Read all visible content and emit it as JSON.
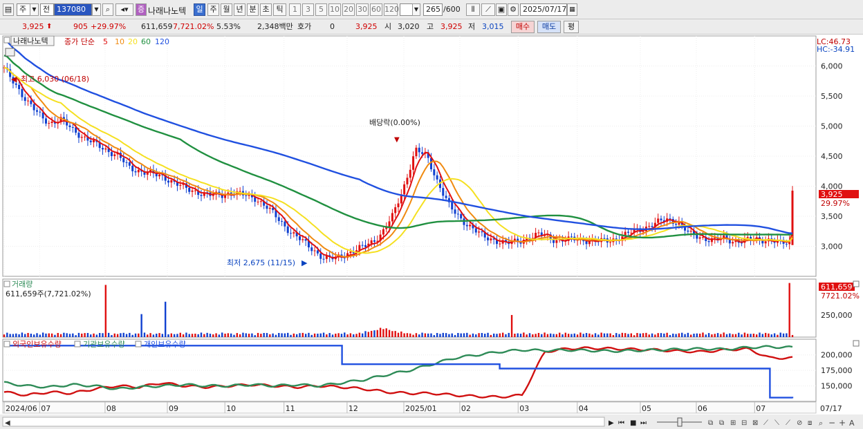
{
  "toolbar": {
    "period_label": "주",
    "mode_label": "전",
    "code": "137080",
    "company_name": "나래나노텍",
    "periods": [
      "일",
      "주",
      "월",
      "년",
      "분",
      "초",
      "틱"
    ],
    "active_period": "일",
    "numbers": [
      "1",
      "3",
      "5",
      "10",
      "20",
      "30",
      "60",
      "120"
    ],
    "count_value": "265",
    "count_total": "/600",
    "date": "2025/07/17"
  },
  "quote": {
    "price": "3,925",
    "change": "905",
    "change_pct": "+29.97%",
    "volume": "611,659",
    "volume_pct": "7,721.02%",
    "turnover": "5.53%",
    "amount": "2,348백만",
    "hoga_label": "호가",
    "hoga_value": "0",
    "hoga_price": "3,925",
    "open_label": "시",
    "open": "3,020",
    "high_label": "고",
    "high": "3,925",
    "low_label": "저",
    "low": "3,015",
    "buy_label": "매수",
    "sell_label": "매도",
    "eval_label": "평"
  },
  "price_panel": {
    "name_tag": "나래나노텍",
    "ma_label": "종가 단순",
    "ma_periods": [
      "5",
      "10",
      "20",
      "60",
      "120"
    ],
    "ma_colors": [
      "#e01010",
      "#f08a10",
      "#f5e020",
      "#209040",
      "#2050e0"
    ],
    "lc_label": "LC:46.73",
    "hc_label": "HC:-34.91",
    "high_note": "최고 6,030 (06/18)",
    "low_note": "최저 2,675 (11/15)",
    "dividend_note": "배당락(0.00%)",
    "last_price_tag": "3,925",
    "last_pct_tag": "29.97%"
  },
  "volume_panel": {
    "title": "거래량",
    "subtitle": "611,659주(7,721.02%)",
    "last_tag": "611,659",
    "last_pct_tag": "7721.02%"
  },
  "holdings_panel": {
    "legends": [
      "외국인보유수량",
      "기관보유수량",
      "개인보유수량"
    ],
    "legend_colors": [
      "#d01010",
      "#2e8b57",
      "#2050e0"
    ]
  },
  "chart_data": [
    {
      "type": "candlestick",
      "title": "나래나노텍",
      "ylim": [
        2500,
        6500
      ],
      "y_ticks": [
        3000,
        3500,
        4000,
        4500,
        5000,
        5500,
        6000
      ],
      "y_tick_labels": [
        "3,000",
        "3,500",
        "4,000",
        "4,500",
        "5,000",
        "5,500",
        "6,000"
      ],
      "x_ticks": [
        "2024/06",
        "07",
        "08",
        "09",
        "10",
        "11",
        "12",
        "2025/01",
        "02",
        "03",
        "04",
        "05",
        "06",
        "07",
        "07/17"
      ],
      "close": [
        5950,
        5700,
        5400,
        5200,
        5050,
        5100,
        4950,
        4800,
        4700,
        4600,
        4500,
        4300,
        4250,
        4200,
        4150,
        4050,
        3950,
        3900,
        3850,
        3850,
        3900,
        3850,
        3800,
        3650,
        3450,
        3250,
        3100,
        2950,
        2800,
        2800,
        2880,
        2950,
        3050,
        3200,
        3500,
        4000,
        4600,
        4500,
        4050,
        3650,
        3450,
        3300,
        3150,
        3100,
        3050,
        3080,
        3150,
        3200,
        3120,
        3100,
        3120,
        3100,
        3080,
        3100,
        3150,
        3250,
        3300,
        3380,
        3450,
        3400,
        3200,
        3150,
        3100,
        3130,
        3080,
        3100,
        3120,
        3100,
        3050,
        3080,
        3925
      ],
      "series": [
        {
          "name": "5"
        },
        {
          "name": "10"
        },
        {
          "name": "20"
        },
        {
          "name": "60"
        },
        {
          "name": "120"
        }
      ]
    },
    {
      "type": "bar",
      "title": "거래량",
      "y_ticks": [
        250000
      ],
      "y_tick_labels": [
        "250,000"
      ],
      "spikes": [
        {
          "at": 0.13,
          "value": 590000
        },
        {
          "at": 0.175,
          "value": 260000
        },
        {
          "at": 0.205,
          "value": 400000
        },
        {
          "at": 0.645,
          "value": 250000
        },
        {
          "at": 0.995,
          "value": 611659
        }
      ]
    },
    {
      "type": "line",
      "y_ticks": [
        150000,
        175000,
        200000
      ],
      "y_tick_labels": [
        "150,000",
        "175,000",
        "200,000"
      ],
      "series": [
        {
          "name": "외국인보유수량",
          "values": [
            140000,
            135000,
            140000,
            138000,
            145000,
            150000,
            148000,
            155000,
            150000,
            148000,
            150000,
            152000,
            150000,
            148000,
            150000,
            148000,
            145000,
            140000,
            138000,
            138000,
            135000,
            133000,
            132000,
            135000,
            205000,
            210000,
            211000,
            210000,
            209000,
            208000,
            206000,
            205000,
            208000,
            210000,
            195000,
            195000
          ]
        },
        {
          "name": "기관보유수량",
          "values": [
            155000,
            150000,
            148000,
            152000,
            150000,
            145000,
            148000,
            150000,
            152000,
            150000,
            150000,
            152000,
            150000,
            152000,
            150000,
            155000,
            160000,
            168000,
            175000,
            185000,
            195000,
            200000,
            205000,
            208000,
            207000,
            208000,
            207000,
            206000,
            207000,
            208000,
            209000,
            210000,
            209000,
            212000,
            213000,
            212000
          ]
        },
        {
          "name": "개인보유수량",
          "values": [
            215000,
            215000,
            215000,
            215000,
            215000,
            215000,
            215000,
            215000,
            215000,
            215000,
            215000,
            215000,
            215000,
            215000,
            215000,
            185000,
            185000,
            185000,
            185000,
            185000,
            185000,
            185000,
            178000,
            178000,
            178000,
            178000,
            178000,
            178000,
            178000,
            178000,
            178000,
            178000,
            178000,
            178000,
            131000,
            130000
          ]
        }
      ]
    }
  ]
}
